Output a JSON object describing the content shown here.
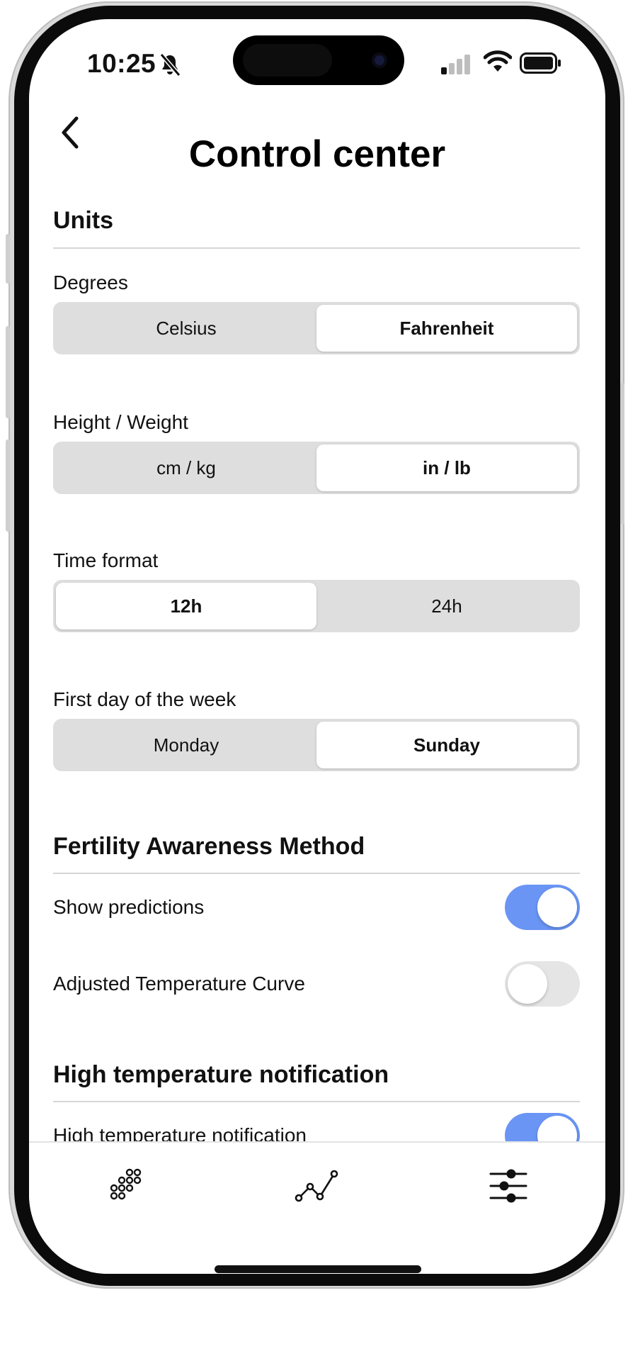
{
  "status_bar": {
    "time": "10:25",
    "icons": [
      "bell-slash-icon",
      "cellular-signal-icon",
      "wifi-icon",
      "battery-icon"
    ]
  },
  "header": {
    "back_icon": "chevron-left-icon",
    "title": "Control center"
  },
  "units": {
    "section_title": "Units",
    "degrees": {
      "label": "Degrees",
      "options": [
        "Celsius",
        "Fahrenheit"
      ],
      "selected": "Fahrenheit"
    },
    "height_weight": {
      "label": "Height / Weight",
      "options": [
        "cm / kg",
        "in / lb"
      ],
      "selected": "in / lb"
    },
    "time_format": {
      "label": "Time format",
      "options": [
        "12h",
        "24h"
      ],
      "selected": "12h"
    },
    "first_day": {
      "label": "First day of the week",
      "options": [
        "Monday",
        "Sunday"
      ],
      "selected": "Sunday"
    }
  },
  "fam": {
    "section_title": "Fertility Awareness Method",
    "show_predictions": {
      "label": "Show predictions",
      "enabled": true
    },
    "adjusted_curve": {
      "label": "Adjusted Temperature Curve",
      "enabled": false
    }
  },
  "high_temp": {
    "section_title": "High temperature notification",
    "notification": {
      "label": "High temperature notification",
      "enabled": true
    }
  },
  "tabbar": {
    "tabs": [
      {
        "icon": "dots-grid-icon",
        "active": false
      },
      {
        "icon": "line-chart-icon",
        "active": false
      },
      {
        "icon": "sliders-icon",
        "active": true
      }
    ]
  },
  "colors": {
    "accent": "#6a95f4",
    "toggle_off": "#e5e5e5",
    "segment_track": "#dedede",
    "divider": "#d6d6d6"
  }
}
